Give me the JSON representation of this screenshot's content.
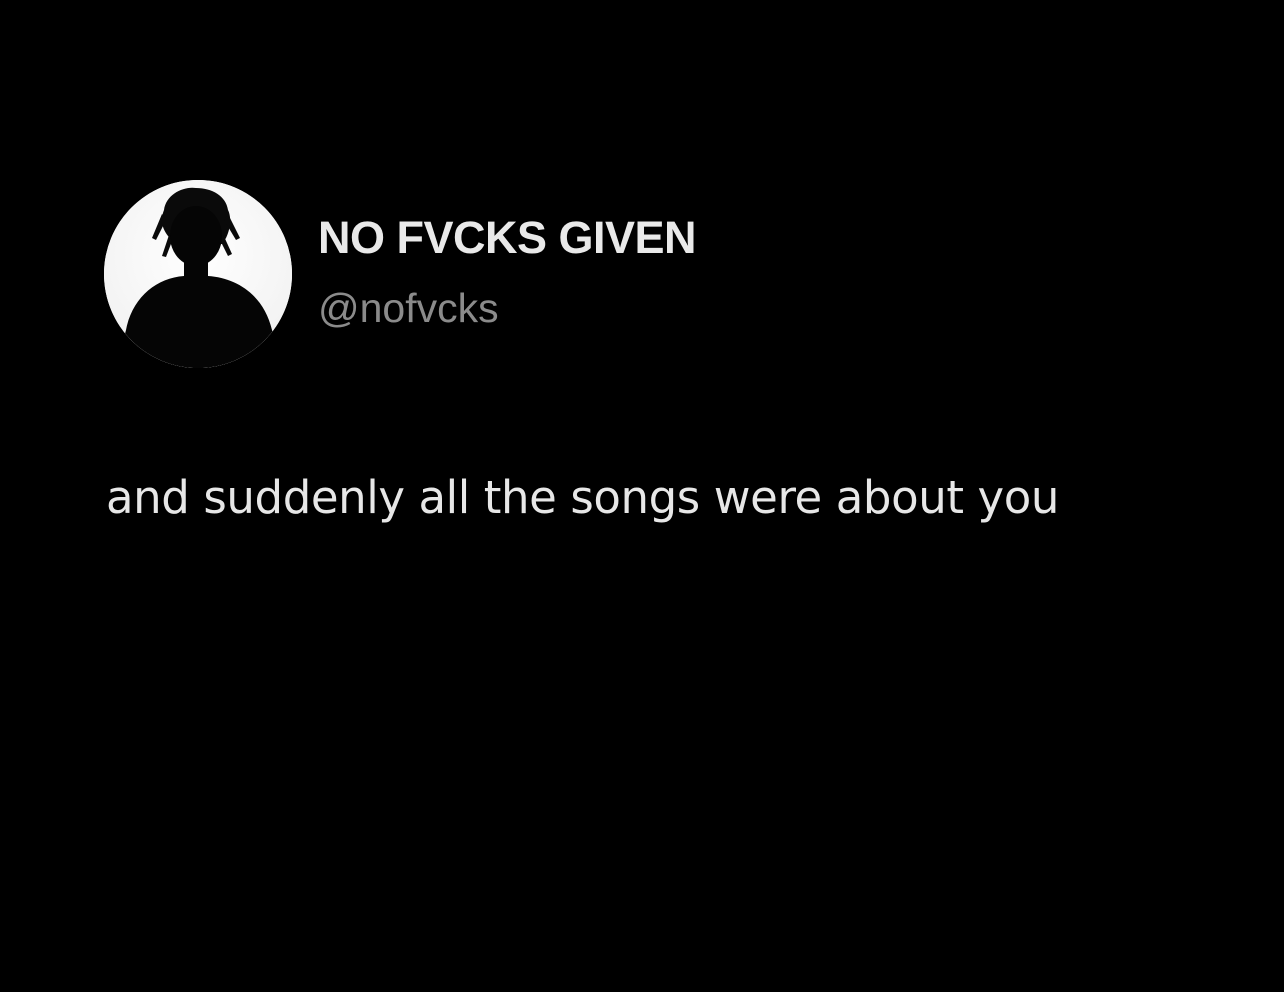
{
  "tweet": {
    "author": {
      "display_name": "NO FVCKS GIVEN",
      "handle": "@nofvcks",
      "avatar_icon": "silhouette-avatar"
    },
    "text": "and suddenly all the songs were about you"
  },
  "colors": {
    "background": "#000000",
    "display_name": "#e9e9e9",
    "handle": "#8b8b8b",
    "text": "#e7e7e7"
  }
}
